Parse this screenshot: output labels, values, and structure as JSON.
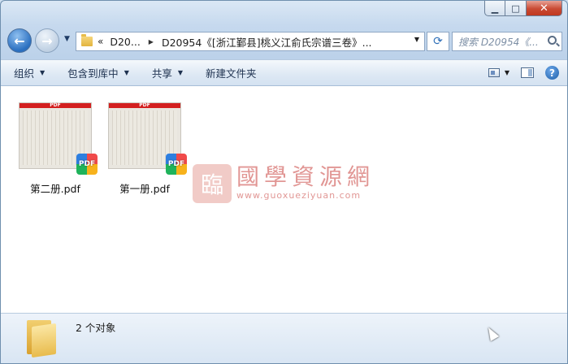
{
  "window": {
    "caption": {
      "minimize": "▁",
      "maximize": "□",
      "close": "✕"
    }
  },
  "nav": {
    "back_icon": "back-arrow-icon",
    "forward_icon": "forward-arrow-icon",
    "address": {
      "overflow": "«",
      "crumbs": [
        "D20...",
        "D20954《[浙江鄞县]桃义江俞氏宗谱三卷》..."
      ],
      "separator": "▶",
      "dropdown": "▼"
    },
    "refresh": "⟳",
    "search_placeholder": "搜索 D20954《..."
  },
  "toolbar": {
    "items": [
      {
        "label": "组织",
        "arrow": "▼"
      },
      {
        "label": "包含到库中",
        "arrow": "▼"
      },
      {
        "label": "共享",
        "arrow": "▼"
      },
      {
        "label": "新建文件夹"
      }
    ],
    "help": "?"
  },
  "files": [
    {
      "name": "第二册.pdf",
      "bar_label": "PDF",
      "badge": "PDF"
    },
    {
      "name": "第一册.pdf",
      "bar_label": "PDF",
      "badge": "PDF"
    }
  ],
  "watermark": {
    "seal": "臨",
    "text": "國學資源網",
    "url": "www.guoxueziyuan.com"
  },
  "status": {
    "count": "2 个对象"
  }
}
